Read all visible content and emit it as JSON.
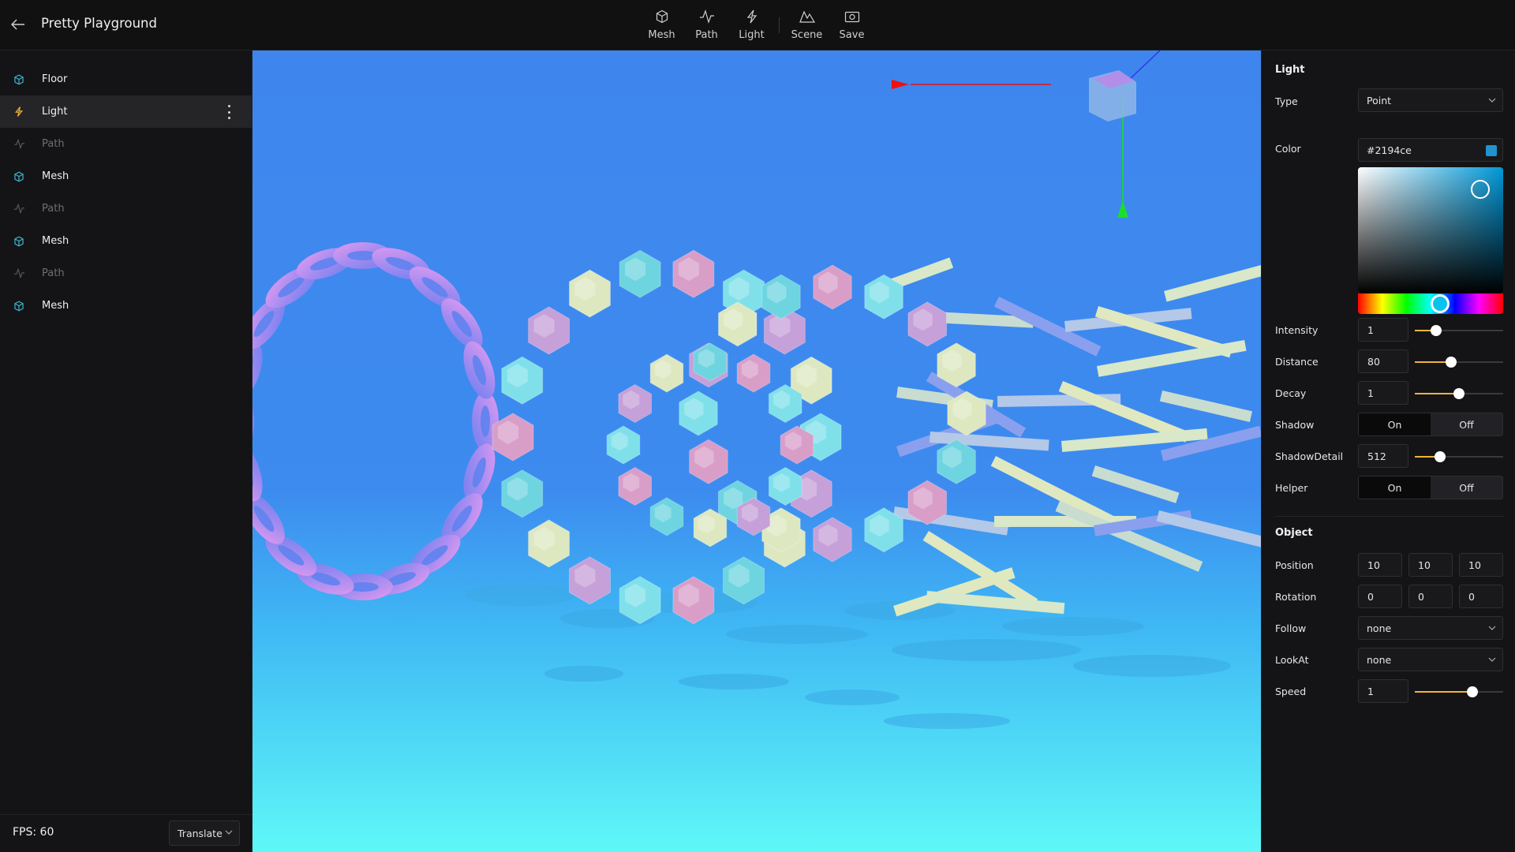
{
  "app": {
    "title": "Pretty Playground"
  },
  "toolbar": {
    "items": [
      {
        "label": "Mesh",
        "icon": "cube-icon"
      },
      {
        "label": "Path",
        "icon": "path-icon"
      },
      {
        "label": "Light",
        "icon": "lightning-icon"
      },
      {
        "label": "Scene",
        "icon": "scene-icon"
      },
      {
        "label": "Save",
        "icon": "camera-icon"
      }
    ]
  },
  "sidebar": {
    "items": [
      {
        "label": "Floor",
        "icon": "cube-icon",
        "selected": false,
        "dim": false
      },
      {
        "label": "Light",
        "icon": "lightning-icon",
        "selected": true,
        "dim": false
      },
      {
        "label": "Path",
        "icon": "path-icon",
        "selected": false,
        "dim": true
      },
      {
        "label": "Mesh",
        "icon": "cube-icon",
        "selected": false,
        "dim": false
      },
      {
        "label": "Path",
        "icon": "path-icon",
        "selected": false,
        "dim": true
      },
      {
        "label": "Mesh",
        "icon": "cube-icon",
        "selected": false,
        "dim": false
      },
      {
        "label": "Path",
        "icon": "path-icon",
        "selected": false,
        "dim": true
      },
      {
        "label": "Mesh",
        "icon": "cube-icon",
        "selected": false,
        "dim": false
      }
    ],
    "fps": "FPS: 60",
    "transform_mode": "Translate"
  },
  "colors": {
    "accent_cyan": "#3ab0c8",
    "accent_yellow": "#f0b43a",
    "light_color": "#2194ce"
  },
  "light": {
    "section_title": "Light",
    "type_label": "Type",
    "type_value": "Point",
    "color_label": "Color",
    "color_value": "#2194ce",
    "intensity_label": "Intensity",
    "intensity_value": "1",
    "intensity_level": 0.24,
    "distance_label": "Distance",
    "distance_value": "80",
    "distance_level": 0.41,
    "decay_label": "Decay",
    "decay_value": "1",
    "decay_level": 0.5,
    "shadow_label": "Shadow",
    "shadow_on": "On",
    "shadow_off": "Off",
    "shadow_active": "On",
    "shadowdetail_label": "ShadowDetail",
    "shadowdetail_value": "512",
    "shadowdetail_level": 0.29,
    "helper_label": "Helper",
    "helper_on": "On",
    "helper_off": "Off",
    "helper_active": "On"
  },
  "object": {
    "section_title": "Object",
    "position_label": "Position",
    "position": [
      "10",
      "10",
      "10"
    ],
    "rotation_label": "Rotation",
    "rotation": [
      "0",
      "0",
      "0"
    ],
    "follow_label": "Follow",
    "follow_value": "none",
    "lookat_label": "LookAt",
    "lookat_value": "none",
    "speed_label": "Speed",
    "speed_value": "1",
    "speed_level": 0.65
  }
}
